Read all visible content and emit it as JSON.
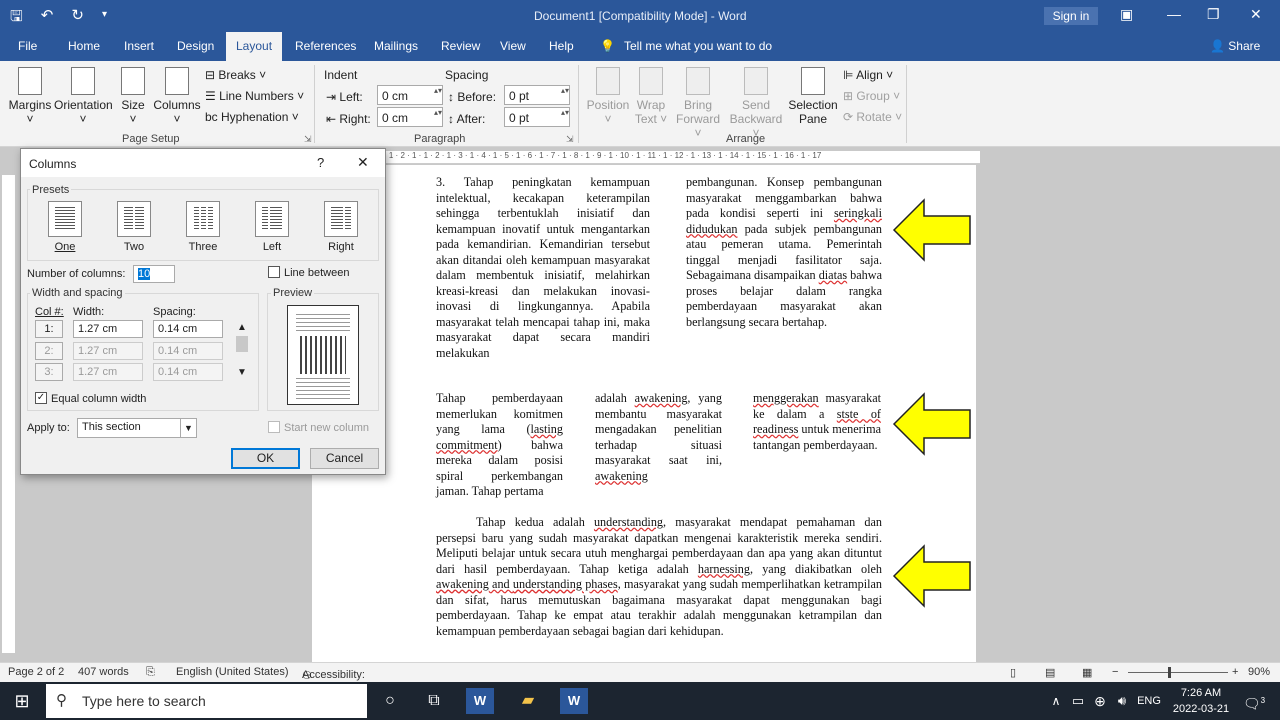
{
  "titlebar": {
    "doc_title": "Document1 [Compatibility Mode]  -  Word",
    "sign_in": "Sign in"
  },
  "tabs": [
    "File",
    "Home",
    "Insert",
    "Design",
    "Layout",
    "References",
    "Mailings",
    "Review",
    "View",
    "Help"
  ],
  "tell_me": "Tell me what you want to do",
  "share": "Share",
  "ribbon": {
    "margins": "Margins",
    "orientation": "Orientation",
    "size": "Size",
    "columns": "Columns",
    "breaks": "Breaks",
    "line_numbers": "Line Numbers",
    "hyphenation": "Hyphenation",
    "page_setup": "Page Setup",
    "indent": "Indent",
    "spacing": "Spacing",
    "left_label": "Left:",
    "left_value": "0 cm",
    "right_label": "Right:",
    "right_value": "0 cm",
    "before_label": "Before:",
    "before_value": "0 pt",
    "after_label": "After:",
    "after_value": "0 pt",
    "paragraph": "Paragraph",
    "position": "Position",
    "wrap_text_1": "Wrap",
    "wrap_text_2": "Text",
    "bring_forward_1": "Bring",
    "bring_forward_2": "Forward",
    "send_backward_1": "Send",
    "send_backward_2": "Backward",
    "selection_pane_1": "Selection",
    "selection_pane_2": "Pane",
    "align": "Align",
    "group": "Group",
    "rotate": "Rotate",
    "arrange": "Arrange"
  },
  "dialog": {
    "title": "Columns",
    "help": "?",
    "presets_label": "Presets",
    "presets": [
      "One",
      "Two",
      "Three",
      "Left",
      "Right"
    ],
    "num_columns_label": "Number of columns:",
    "num_columns_value": "10",
    "line_between": "Line between",
    "width_spacing_label": "Width and spacing",
    "preview_label": "Preview",
    "col_header": "Col #:",
    "width_header": "Width:",
    "spacing_header": "Spacing:",
    "rows": [
      {
        "col": "1:",
        "width": "1.27 cm",
        "spacing": "0.14 cm"
      },
      {
        "col": "2:",
        "width": "1.27 cm",
        "spacing": "0.14 cm"
      },
      {
        "col": "3:",
        "width": "1.27 cm",
        "spacing": "0.14 cm"
      }
    ],
    "equal_width": "Equal column width",
    "apply_to_label": "Apply to:",
    "apply_to_value": "This section",
    "start_new_column": "Start new column",
    "ok": "OK",
    "cancel": "Cancel"
  },
  "ruler_text": "· 1 · 2 · 1 · 1 · 2 · 1 · 3 · 1 · 4 · 1 · 5 · 1 · 6 · 1 · 7 · 1 · 8 · 1 · 9 · 1 · 10 · 1 · 11 · 1 · 12 · 1 · 13 · 1 · 14 · 1 · 15 · 1 · 16 · 1 · 17",
  "document": {
    "sec1_col1": "3.  Tahap peningkatan kemampuan intelektual, kecakapan keterampilan sehingga terbentuklah inisiatif dan kemampuan inovatif untuk mengantarkan pada kemandirian. Kemandirian tersebut akan ditandai oleh kemampuan masyarakat dalam membentuk inisiatif, melahirkan kreasi-kreasi dan melakukan inovasi-inovasi di lingkungannya. Apabila masyarakat telah mencapai tahap ini, maka masyarakat dapat secara mandiri melakukan",
    "sec1_col2": "pembangunan. Konsep pembangunan masyarakat menggambarkan bahwa pada kondisi seperti ini seringkali didudukan pada subjek pembangunan atau pemeran utama. Pemerintah tinggal menjadi fasilitator saja. Sebagaimana disampaikan diatas bahwa proses belajar dalam rangka pemberdayaan masyarakat akan berlangsung secara bertahap.",
    "sec2_col1": "Tahap pemberdayaan memerlukan komitmen yang lama (lasting commitment) bahwa mereka dalam posisi spiral perkembangan jaman. Tahap pertama",
    "sec2_col2": "adalah awakening, yang membantu masyarakat mengadakan penelitian terhadap situasi masyarakat saat ini, awakening",
    "sec2_col3": "menggerakan masyarakat ke dalam a stste of readiness untuk menerima tantangan pemberdayaan.",
    "sec3": "Tahap kedua adalah understanding, masyarakat mendapat pemahaman dan persepsi baru yang sudah masyarakat dapatkan mengenai karakteristik mereka sendiri. Meliputi belajar untuk secara utuh menghargai pemberdayaan dan apa yang akan dituntut dari hasil pemberdayaan. Tahap ketiga adalah harnessing, yang diakibatkan oleh awakening and understanding phases, masyarakat yang sudah memperlihatkan ketrampilan dan sifat, harus memutuskan bagaimana masyarakat dapat menggunakan bagi pemberdayaan. Tahap ke empat atau terakhir adalah menggunakan ketrampilan dan kemampuan pemberdayaan sebagai bagian dari kehidupan."
  },
  "status": {
    "page": "Page 2 of 2",
    "words": "407 words",
    "language": "English (United States)",
    "accessibility": "Accessibility: Good to go",
    "zoom": "90%"
  },
  "taskbar": {
    "search_placeholder": "Type here to search",
    "lang": "ENG",
    "time": "7:26 AM",
    "date": "2022-03-21",
    "notif_count": "3"
  },
  "colors": {
    "word_blue": "#2b579a",
    "arrow_fill": "#ffff00",
    "squiggle": "#dd3333"
  }
}
